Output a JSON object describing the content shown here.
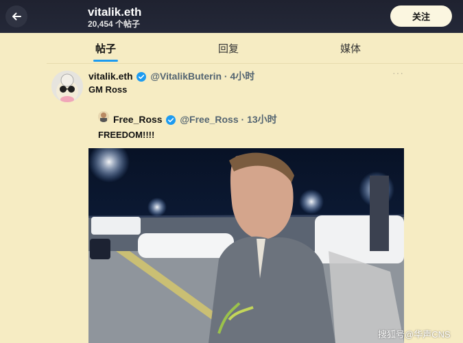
{
  "header": {
    "title": "vitalik.eth",
    "post_count": "20,454 个帖子",
    "follow_label": "关注",
    "back_icon": "arrow-left-icon"
  },
  "tabs": [
    {
      "label": "帖子",
      "active": true
    },
    {
      "label": "回复",
      "active": false
    },
    {
      "label": "媒体",
      "active": false
    }
  ],
  "tweet": {
    "name": "vitalik.eth",
    "handle": "@VitalikButerin",
    "time": "· 4小时",
    "text": "GM Ross",
    "more_icon": "more-icon"
  },
  "quote": {
    "name": "Free_Ross",
    "handle": "@Free_Ross",
    "time": "· 13小时",
    "text": "FREEDOM!!!!"
  },
  "watermark": "搜狐号@华声CNS",
  "colors": {
    "header_bg": "#1f2230",
    "page_bg": "#f6ecc3",
    "accent": "#1d9bf0",
    "verified": "#1d9bf0"
  }
}
